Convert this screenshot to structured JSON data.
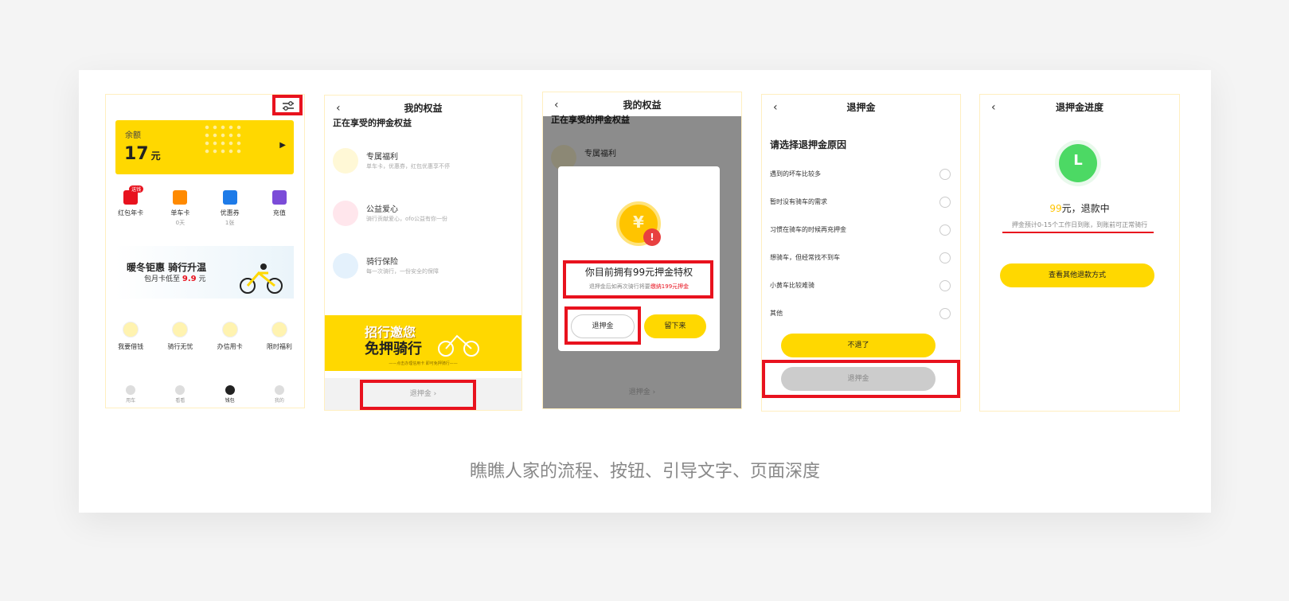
{
  "screen1": {
    "balance_label": "余额",
    "balance_value": "17",
    "balance_unit": "元",
    "shortcuts": [
      {
        "label": "红包年卡",
        "sub": "",
        "badge": "送钱",
        "color": "#e8121e"
      },
      {
        "label": "单车卡",
        "sub": "0天",
        "badge": "",
        "color": "#ff8a00"
      },
      {
        "label": "优惠券",
        "sub": "1张",
        "badge": "",
        "color": "#1e7be8"
      },
      {
        "label": "充值",
        "sub": "",
        "badge": "",
        "color": "#7b4cd8"
      }
    ],
    "banner_title": "暖冬钜惠 骑行升温",
    "banner_sub_prefix": "包月卡低至",
    "banner_price": "9.9",
    "banner_unit": "元",
    "services": [
      "我要借钱",
      "骑行无忧",
      "办信用卡",
      "限时福利"
    ],
    "tabs": [
      "用车",
      "看看",
      "钱包",
      "我的"
    ]
  },
  "screen2": {
    "title": "我的权益",
    "section": "正在享受的押金权益",
    "items": [
      {
        "title": "专属福利",
        "desc": "单车卡，优惠券，红包优惠享不停"
      },
      {
        "title": "公益爱心",
        "desc": "骑行贡献爱心，ofo公益有你一份"
      },
      {
        "title": "骑行保险",
        "desc": "每一次骑行，一份安全的保障"
      }
    ],
    "banner_line1": "招行邀您",
    "banner_line2": "免押骑行",
    "banner_note": "——点击办理信用卡 即可免押骑行——",
    "footer": "退押金 ›"
  },
  "screen3": {
    "title": "我的权益",
    "section": "正在享受的押金权益",
    "item": "专属福利",
    "modal_title": "你目前拥有99元押金特权",
    "modal_sub": "退押金后如再次骑行将要",
    "modal_sub_red": "缴纳199元押金",
    "btn_refund": "退押金",
    "btn_stay": "留下来",
    "footer": "退押金 ›",
    "coin_glyph": "¥"
  },
  "screen4": {
    "title": "退押金",
    "heading": "请选择退押金原因",
    "options": [
      "遇到的坏车比较多",
      "暂时没有骑车的需求",
      "习惯在骑车的时候再充押金",
      "想骑车，但经常找不到车",
      "小黄车比较难骑",
      "其他"
    ],
    "btn_keep": "不退了",
    "btn_refund": "退押金"
  },
  "screen5": {
    "title": "退押金进度",
    "amount": "99",
    "status": "元，退款中",
    "note": "押金预计0-15个工作日到账，到账前可正常骑行",
    "btn": "查看其他退款方式",
    "clock_glyph": "L"
  },
  "caption": "瞧瞧人家的流程、按钮、引导文字、页面深度",
  "back_glyph": "‹",
  "colors": {
    "brand_yellow": "#ffd800",
    "highlight_red": "#e8121e"
  }
}
